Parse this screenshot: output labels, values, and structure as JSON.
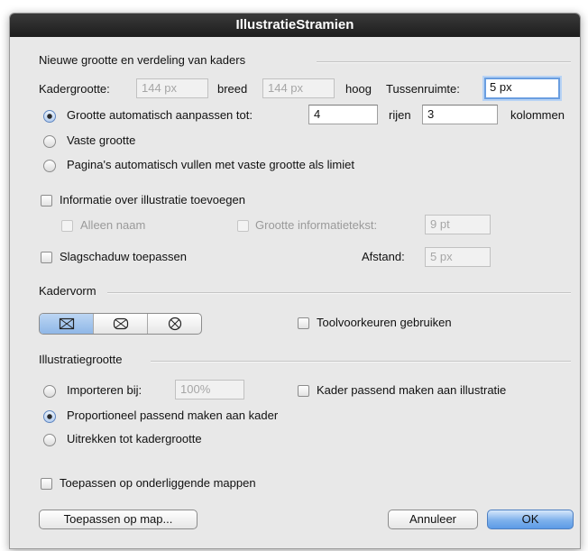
{
  "dialog": {
    "title": "IllustratieStramien"
  },
  "sizing": {
    "section_label": "Nieuwe grootte en verdeling van kaders",
    "frame_size_label": "Kadergrootte:",
    "width_value": "144 px",
    "width_unit_label": "breed",
    "height_value": "144 px",
    "height_unit_label": "hoog",
    "spacing_label": "Tussenruimte:",
    "spacing_value": "5 px",
    "auto_fit_label": "Grootte automatisch aanpassen tot:",
    "rows_value": "4",
    "rows_label": "rijen",
    "columns_value": "3",
    "columns_label": "kolommen",
    "fixed_size_label": "Vaste grootte",
    "auto_fill_label": "Pagina's automatisch vullen met vaste grootte als limiet",
    "selected_option": "auto_fit"
  },
  "info": {
    "add_info_label": "Informatie over illustratie toevoegen",
    "name_only_label": "Alleen naam",
    "info_text_size_label": "Grootte informatietekst:",
    "info_text_size_value": "9 pt",
    "drop_shadow_label": "Slagschaduw toepassen",
    "distance_label": "Afstand:",
    "distance_value": "5 px"
  },
  "frame_shape": {
    "section_label": "Kadervorm",
    "shape_icons": [
      "frame-square-cross-icon",
      "frame-rounded-cross-icon",
      "frame-circle-cross-icon"
    ],
    "selected_index": 0,
    "tool_prefs_label": "Toolvoorkeuren gebruiken"
  },
  "illustration_size": {
    "section_label": "Illustratiegrootte",
    "import_at_label": "Importeren bij:",
    "import_at_value": "100%",
    "fit_frame_to_illustration_label": "Kader passend maken aan illustratie",
    "proportional_label": "Proportioneel passend maken aan kader",
    "stretch_label": "Uitrekken tot kadergrootte",
    "selected_option": "proportional"
  },
  "subfolders": {
    "apply_subfolders_label": "Toepassen op onderliggende mappen"
  },
  "footer": {
    "apply_to_folder_label": "Toepassen op map...",
    "cancel_label": "Annuleer",
    "ok_label": "OK"
  },
  "colors": {
    "focus_ring": "#6a9ee0",
    "default_button": "#5c9be6",
    "title_bar": "#1d1d1d"
  }
}
